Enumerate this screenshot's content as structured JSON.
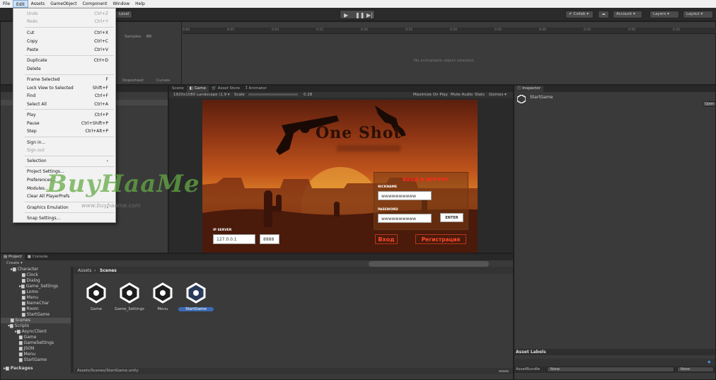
{
  "menubar": {
    "items": [
      "File",
      "Edit",
      "Assets",
      "GameObject",
      "Component",
      "Window",
      "Help"
    ]
  },
  "toolbar": {
    "local": "Local",
    "collab": "Collab ▾",
    "account": "Account",
    "layers": "Layers",
    "layout": "Layout"
  },
  "edit_menu": {
    "groups": [
      [
        {
          "label": "Undo",
          "shortcut": "Ctrl+Z",
          "disabled": true
        },
        {
          "label": "Redo",
          "shortcut": "Ctrl+Y",
          "disabled": true
        }
      ],
      [
        {
          "label": "Cut",
          "shortcut": "Ctrl+X"
        },
        {
          "label": "Copy",
          "shortcut": "Ctrl+C"
        },
        {
          "label": "Paste",
          "shortcut": "Ctrl+V"
        }
      ],
      [
        {
          "label": "Duplicate",
          "shortcut": "Ctrl+D"
        },
        {
          "label": "Delete",
          "shortcut": ""
        }
      ],
      [
        {
          "label": "Frame Selected",
          "shortcut": "F"
        },
        {
          "label": "Lock View to Selected",
          "shortcut": "Shift+F"
        },
        {
          "label": "Find",
          "shortcut": "Ctrl+F"
        },
        {
          "label": "Select All",
          "shortcut": "Ctrl+A"
        }
      ],
      [
        {
          "label": "Play",
          "shortcut": "Ctrl+P"
        },
        {
          "label": "Pause",
          "shortcut": "Ctrl+Shift+P"
        },
        {
          "label": "Step",
          "shortcut": "Ctrl+Alt+P"
        }
      ],
      [
        {
          "label": "Sign in...",
          "shortcut": ""
        },
        {
          "label": "Sign out",
          "shortcut": "",
          "disabled": true
        }
      ],
      [
        {
          "label": "Selection",
          "shortcut": "›"
        }
      ],
      [
        {
          "label": "Project Settings...",
          "shortcut": ""
        },
        {
          "label": "Preferences...",
          "shortcut": ""
        },
        {
          "label": "Modules...",
          "shortcut": ""
        },
        {
          "label": "Clear All PlayerPrefs",
          "shortcut": ""
        }
      ],
      [
        {
          "label": "Graphics Emulation",
          "shortcut": "›"
        }
      ],
      [
        {
          "label": "Snap Settings...",
          "shortcut": ""
        }
      ]
    ]
  },
  "animation": {
    "samples_label": "Samples",
    "samples_value": "60",
    "dopesheet": "Dopesheet",
    "curves": "Curves",
    "empty": "No animatable object selected.",
    "ticks": [
      "0:00",
      "0:05",
      "0:10",
      "0:15",
      "0:20",
      "0:25",
      "0:30",
      "0:35",
      "0:40",
      "0:45",
      "0:50",
      "0:55"
    ]
  },
  "tabs": {
    "scene": "Scene",
    "game": "Game",
    "asset_store": "Asset Store",
    "animator": "Animator",
    "inspector": "Inspector",
    "project": "Project",
    "console": "Console"
  },
  "game_toolbar": {
    "resolution": "1920x1080 Landscape (1.9 ▾",
    "scale_label": "Scale",
    "scale_value": "0.28",
    "maximize": "Maximize On Play",
    "mute": "Mute Audio",
    "stats": "Stats",
    "gizmos": "Gizmos ▾"
  },
  "game": {
    "title": "One Shot",
    "login_title": "ВХОД В ИГРУХУ",
    "nickname_label": "NICKNAME",
    "nickname_value": "wwwwwwwwww",
    "password_label": "PASSWORD",
    "password_value": "wwwwwwwwww",
    "enter_button": "ENTER",
    "ip_label": "IP SERVER",
    "ip_value": "127.0.0.1",
    "port_value": "8888",
    "login_button": "Вход",
    "register_button": "Регистрация"
  },
  "inspector": {
    "name": "StartGame",
    "open": "Open"
  },
  "project": {
    "create": "Create ▾",
    "breadcrumb_root": "Assets",
    "breadcrumb_leaf": "Scenes",
    "tree": [
      {
        "label": "Character",
        "indent": 1
      },
      {
        "label": "Clock",
        "indent": 2
      },
      {
        "label": "Dialog",
        "indent": 2
      },
      {
        "label": "Game_Settings",
        "indent": 2
      },
      {
        "label": "Lomo",
        "indent": 2
      },
      {
        "label": "Menu",
        "indent": 2
      },
      {
        "label": "NameChar",
        "indent": 2
      },
      {
        "label": "Room",
        "indent": 2
      },
      {
        "label": "StartGame",
        "indent": 2
      },
      {
        "label": "Scenes",
        "indent": 1
      },
      {
        "label": "Scripts",
        "indent": 1
      },
      {
        "label": "AsyncClient",
        "indent": 2
      },
      {
        "label": "Game",
        "indent": 2
      },
      {
        "label": "GameSettings",
        "indent": 2
      },
      {
        "label": "JSON",
        "indent": 2
      },
      {
        "label": "Menu",
        "indent": 2
      },
      {
        "label": "StartGame",
        "indent": 2
      },
      {
        "label": "Packages",
        "indent": 0
      }
    ],
    "assets": [
      "Game",
      "Game_Settings",
      "Menu",
      "StartGame"
    ],
    "status_path": "Assets/Scenes/StartGame.unity"
  },
  "asset_labels": {
    "title": "Asset Labels",
    "bundle_label": "AssetBundle",
    "bundle_value": "None",
    "variant_value": "None"
  },
  "watermark": {
    "text": "BuyHaaMe",
    "sub": "www.buyhaame.com"
  }
}
